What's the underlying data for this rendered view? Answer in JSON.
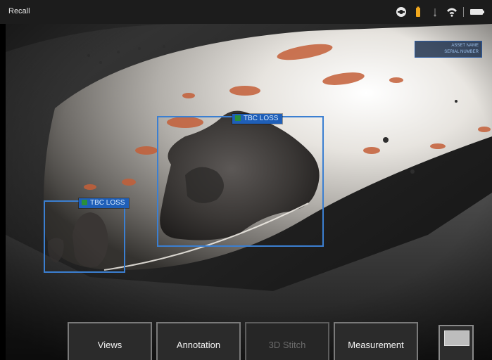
{
  "status_bar": {
    "title": "Recall",
    "icons": [
      "record-icon",
      "battery-warning-icon",
      "usb-icon",
      "wifi-icon",
      "battery-icon"
    ]
  },
  "camera": {
    "content": "borescope-image"
  },
  "detections": [
    {
      "label": "TBC LOSS"
    },
    {
      "label": "TBC LOSS"
    }
  ],
  "overlay_tag": {
    "line1": "ASSET NAME",
    "line2": "SERIAL NUMBER"
  },
  "bottom_menu": {
    "buttons": [
      {
        "label": "Views",
        "enabled": true
      },
      {
        "label": "Annotation",
        "enabled": true
      },
      {
        "label": "3D Stitch",
        "enabled": false
      },
      {
        "label": "Measurement",
        "enabled": true
      }
    ]
  },
  "colors": {
    "detection_box": "#3b7fd1",
    "detection_label_bg": "#1f5fb8",
    "status_bar_bg": "#1c1c1c",
    "menu_bg": "#2b2b2b",
    "battery_warning": "#f2a81d"
  }
}
